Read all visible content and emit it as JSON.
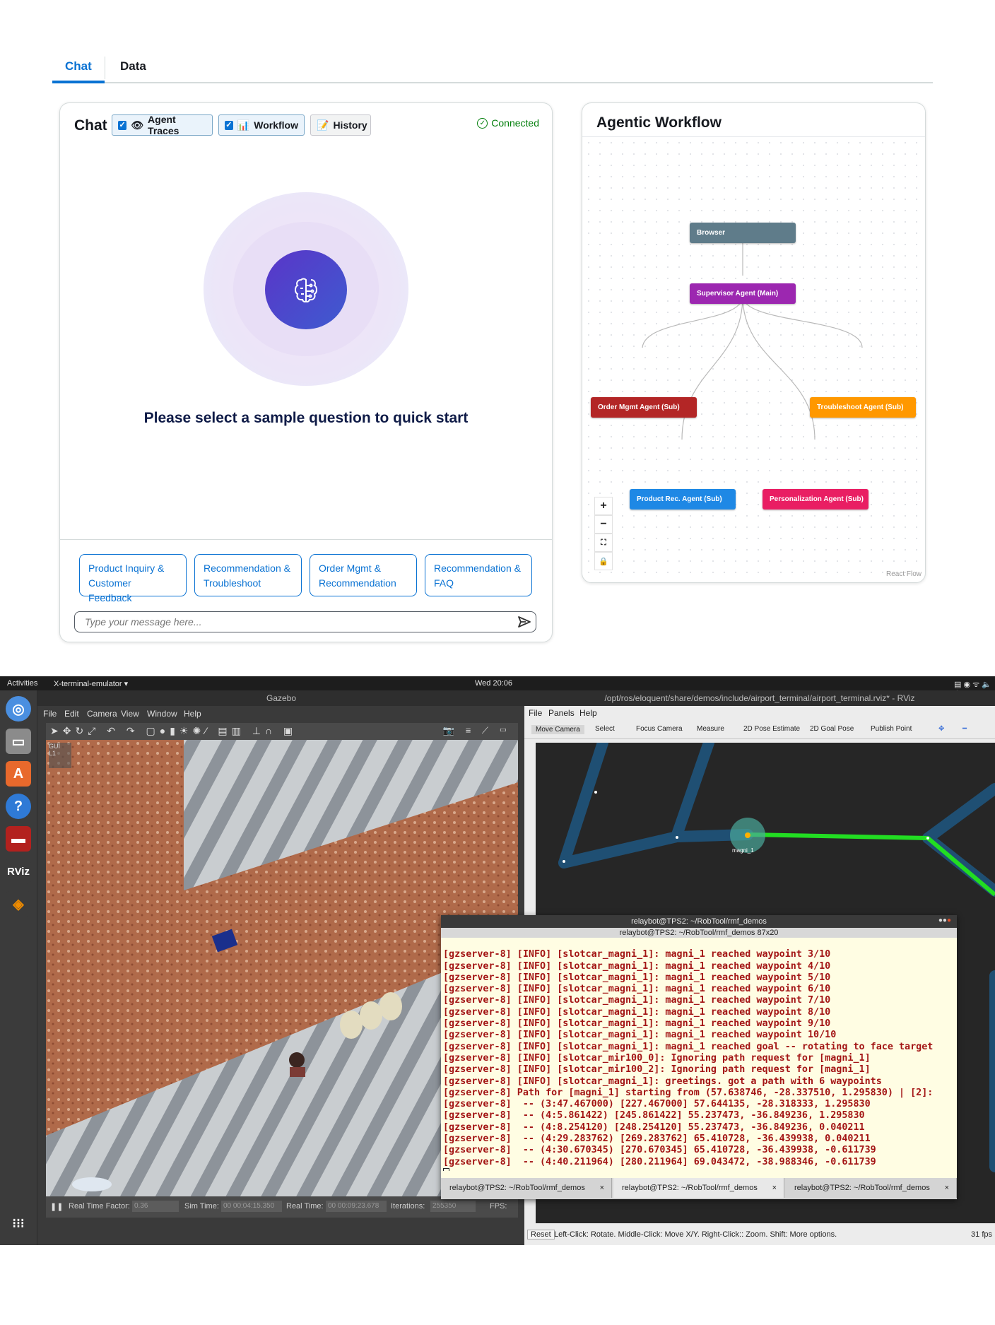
{
  "tabs": {
    "chat": "Chat",
    "data": "Data"
  },
  "chat": {
    "title": "Chat",
    "toggles": {
      "agent_traces": "Agent Traces",
      "workflow": "Workflow",
      "history": "History"
    },
    "status": "Connected",
    "prompt": "Please select a sample question to quick start",
    "samples": [
      {
        "line1": "Product Inquiry &",
        "line2": "Customer Feedback"
      },
      {
        "line1": "Recommendation &",
        "line2": "Troubleshoot"
      },
      {
        "line1": "Order Mgmt &",
        "line2": "Recommendation"
      },
      {
        "line1": "Recommendation &",
        "line2": "FAQ"
      }
    ],
    "input_placeholder": "Type your message here..."
  },
  "workflow": {
    "title": "Agentic Workflow",
    "nodes": [
      {
        "label": "Browser",
        "color": "#5f7c8a"
      },
      {
        "label": "Supervisor Agent (Main)",
        "color": "#9c27b0"
      },
      {
        "label": "Order Mgmt Agent (Sub)",
        "color": "#b32626"
      },
      {
        "label": "Troubleshoot Agent (Sub)",
        "color": "#ff9800"
      },
      {
        "label": "Product Rec. Agent (Sub)",
        "color": "#1e88e5"
      },
      {
        "label": "Personalization Agent (Sub)",
        "color": "#e91e63"
      }
    ],
    "watermark": "React Flow"
  },
  "desktop": {
    "topbar": {
      "activities": "Activities",
      "app": "X-terminal-emulator ▾",
      "clock": "Wed 20:06"
    },
    "gazebo": {
      "title": "Gazebo",
      "menu": [
        "File",
        "Edit",
        "Camera",
        "View",
        "Window",
        "Help"
      ],
      "status": {
        "rtf_label": "Real Time Factor:",
        "rtf": "0.36",
        "sim_label": "Sim Time:",
        "sim": "00 00:04:15.350",
        "real_label": "Real Time:",
        "real": "00 00:09:23.678",
        "iter_label": "Iterations:",
        "iter": "255350",
        "fps_label": "FPS:"
      }
    },
    "rviz": {
      "title": "/opt/ros/eloquent/share/demos/include/airport_terminal/airport_terminal.rviz* - RViz",
      "menu": [
        "File",
        "Panels",
        "Help"
      ],
      "tools": [
        "Move Camera",
        "Select",
        "Focus Camera",
        "Measure",
        "2D Pose Estimate",
        "2D Goal Pose",
        "Publish Point"
      ],
      "robot_label": "magni_1",
      "status_reset": "Reset",
      "status_help": "Left-Click: Rotate. Middle-Click: Move X/Y. Right-Click:: Zoom. Shift: More options.",
      "fps": "31 fps"
    },
    "terminal": {
      "title": "relaybot@TPS2: ~/RobTool/rmf_demos",
      "subtitle": "relaybot@TPS2: ~/RobTool/rmf_demos 87x20",
      "lines": [
        "[gzserver-8] [INFO] [slotcar_magni_1]: magni_1 reached waypoint 3/10",
        "[gzserver-8] [INFO] [slotcar_magni_1]: magni_1 reached waypoint 4/10",
        "[gzserver-8] [INFO] [slotcar_magni_1]: magni_1 reached waypoint 5/10",
        "[gzserver-8] [INFO] [slotcar_magni_1]: magni_1 reached waypoint 6/10",
        "[gzserver-8] [INFO] [slotcar_magni_1]: magni_1 reached waypoint 7/10",
        "[gzserver-8] [INFO] [slotcar_magni_1]: magni_1 reached waypoint 8/10",
        "[gzserver-8] [INFO] [slotcar_magni_1]: magni_1 reached waypoint 9/10",
        "[gzserver-8] [INFO] [slotcar_magni_1]: magni_1 reached waypoint 10/10",
        "[gzserver-8] [INFO] [slotcar_magni_1]: magni_1 reached goal -- rotating to face target",
        "[gzserver-8] [INFO] [slotcar_mir100_0]: Ignoring path request for [magni_1]",
        "[gzserver-8] [INFO] [slotcar_mir100_2]: Ignoring path request for [magni_1]",
        "[gzserver-8] [INFO] [slotcar_magni_1]: greetings. got a path with 6 waypoints",
        "[gzserver-8] Path for [magni_1] starting from (57.638746, -28.337510, 1.295830) | [2]:",
        "[gzserver-8]  -- (3:47.467000) [227.467000] 57.644135, -28.318333, 1.295830",
        "[gzserver-8]  -- (4:5.861422) [245.861422] 55.237473, -36.849236, 1.295830",
        "[gzserver-8]  -- (4:8.254120) [248.254120] 55.237473, -36.849236, 0.040211",
        "[gzserver-8]  -- (4:29.283762) [269.283762] 65.410728, -36.439938, 0.040211",
        "[gzserver-8]  -- (4:30.670345) [270.670345] 65.410728, -36.439938, -0.611739",
        "[gzserver-8]  -- (4:40.211964) [280.211964] 69.043472, -38.988346, -0.611739"
      ],
      "tabs": [
        "relaybot@TPS2: ~/RobTool/rmf_demos",
        "relaybot@TPS2: ~/RobTool/rmf_demos",
        "relaybot@TPS2: ~/RobTool/rmf_demos"
      ]
    }
  }
}
